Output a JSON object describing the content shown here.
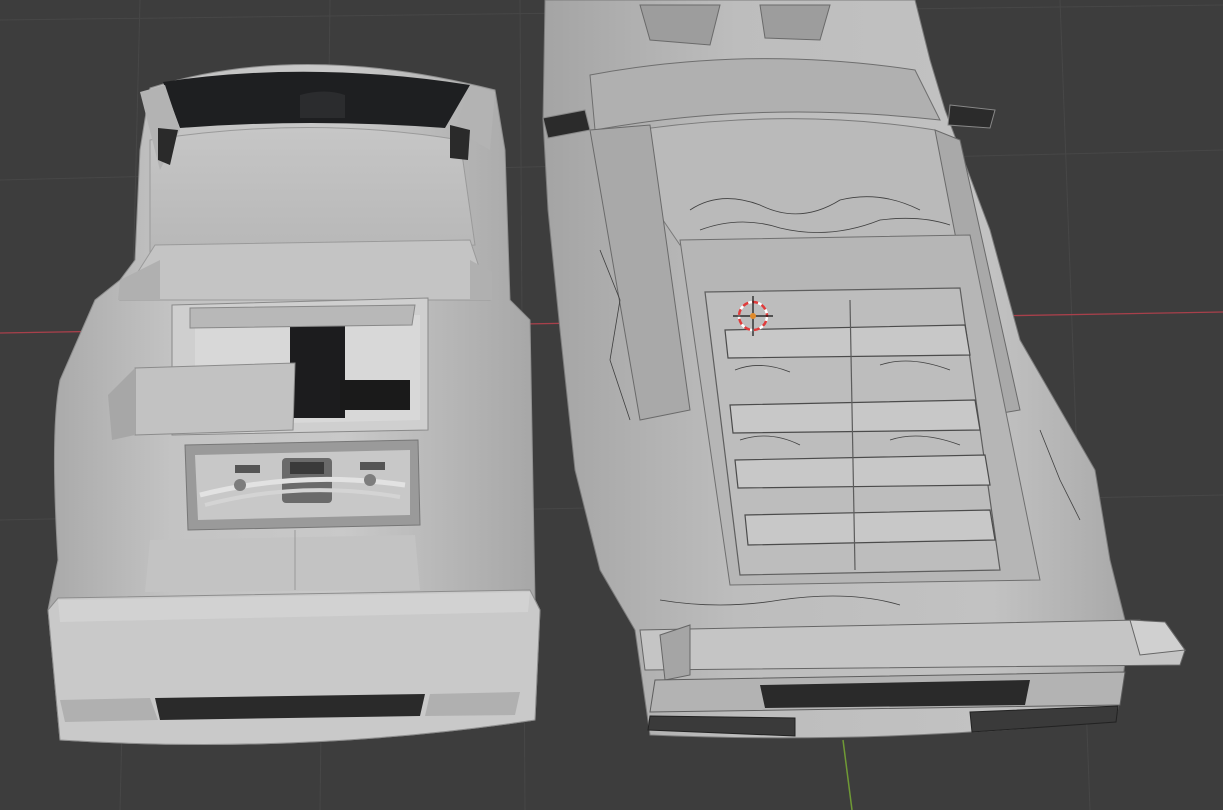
{
  "app": "3D viewport",
  "viewport": {
    "background": "#3d3d3d",
    "grid_color": "#4a4a4a",
    "x_axis_color": "#b0424f",
    "y_axis_color": "#7aa33a"
  },
  "objects": [
    {
      "name": "clean-car-body",
      "material": "solid-grey"
    },
    {
      "name": "scanned-car-body",
      "material": "solid-grey-with-wireframe-artifacts"
    }
  ],
  "gizmo": {
    "type": "3d-cursor",
    "colors": [
      "#ffffff",
      "#e03b3b"
    ]
  }
}
